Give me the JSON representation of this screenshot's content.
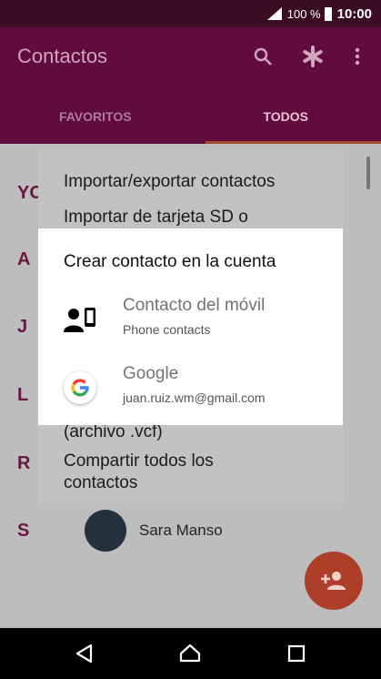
{
  "status_bar": {
    "battery": "100 %",
    "time": "10:00"
  },
  "app_bar": {
    "title": "Contactos",
    "icons": [
      "search-icon",
      "asterisk-icon",
      "more-vert-icon"
    ],
    "tabs": [
      {
        "label": "FAVORITOS",
        "active": false
      },
      {
        "label": "TODOS",
        "active": true
      }
    ]
  },
  "list": {
    "letters": [
      "YO",
      "A",
      "J",
      "L",
      "R",
      "S"
    ],
    "contact": {
      "name": "Sara Manso"
    }
  },
  "background_menu": {
    "title": "Importar/exportar contactos",
    "items": [
      "Importar de tarjeta SD o",
      "(archivo .vcf)",
      "Compartir todos los",
      "contactos"
    ]
  },
  "dialog": {
    "title": "Crear contacto en la cuenta",
    "options": [
      {
        "label": "Contacto del móvil",
        "sublabel": "Phone contacts",
        "icon": "phone-contacts-icon"
      },
      {
        "label": "Google",
        "sublabel": "juan.ruiz.wm@gmail.com",
        "icon": "google-icon"
      }
    ]
  },
  "colors": {
    "app_bar": "#620b3f",
    "status_bar": "#3a0d21",
    "fab": "#ad3f28",
    "accent_tab": "#a44a2f"
  }
}
